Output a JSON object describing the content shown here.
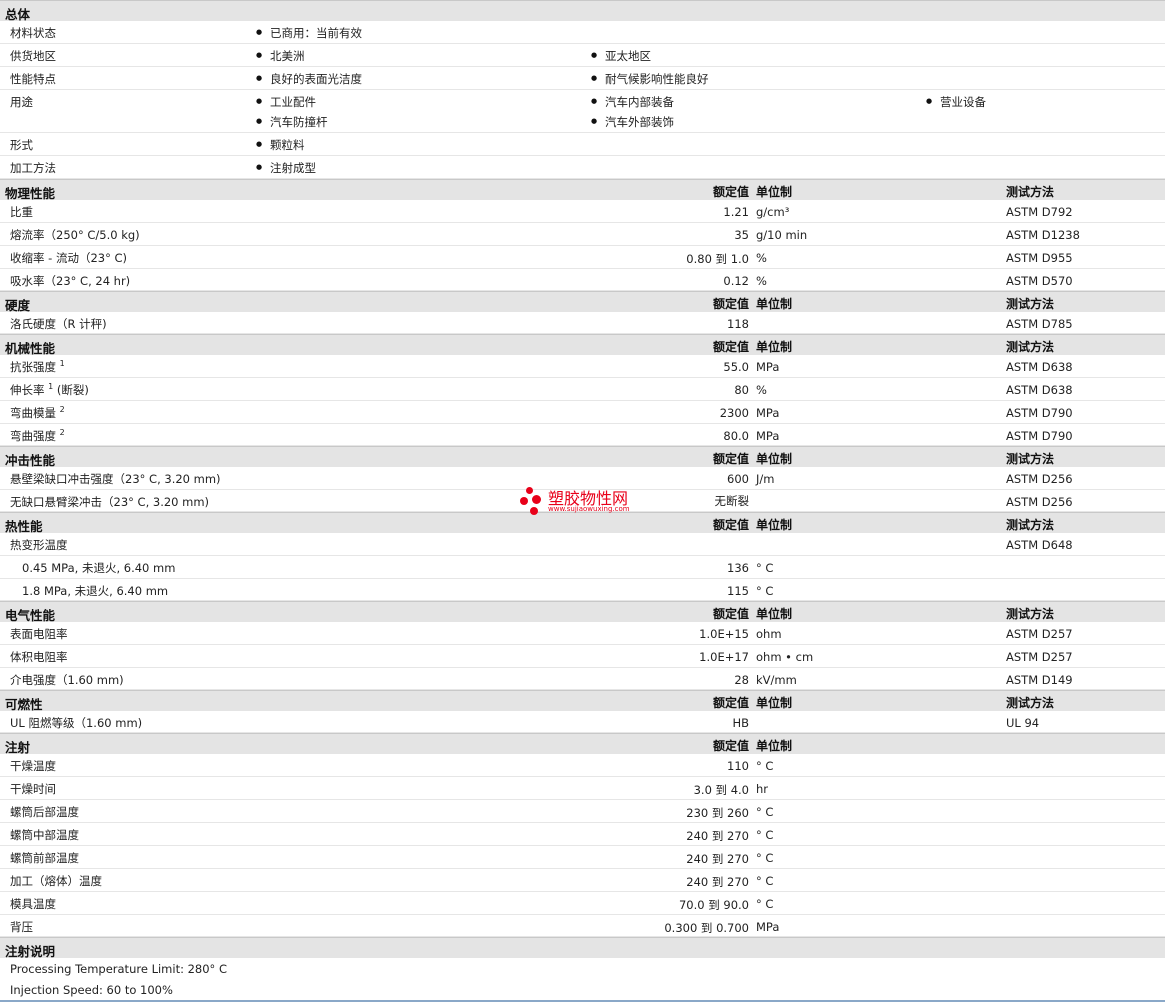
{
  "general": {
    "title": "总体",
    "rows": [
      {
        "label": "材料状态",
        "items": [
          "已商用：当前有效"
        ]
      },
      {
        "label": "供货地区",
        "items": [
          "北美洲",
          "亚太地区"
        ]
      },
      {
        "label": "性能特点",
        "items": [
          "良好的表面光洁度",
          "耐气候影响性能良好"
        ]
      },
      {
        "label": "用途",
        "items": [
          "工业配件",
          "汽车内部装备",
          "营业设备",
          "汽车防撞杆",
          "汽车外部装饰"
        ]
      },
      {
        "label": "形式",
        "items": [
          "颗粒料"
        ]
      },
      {
        "label": "加工方法",
        "items": [
          "注射成型"
        ]
      }
    ]
  },
  "headers": {
    "value": "额定值",
    "unit": "单位制",
    "method": "测试方法"
  },
  "sections": [
    {
      "title": "物理性能",
      "rows": [
        {
          "label": "比重",
          "value": "1.21",
          "unit": "g/cm³",
          "method": "ASTM D792"
        },
        {
          "label": "熔流率（250° C/5.0 kg)",
          "value": "35",
          "unit": "g/10 min",
          "method": "ASTM D1238"
        },
        {
          "label": "收缩率 - 流动（23° C)",
          "value": "0.80 到  1.0",
          "unit": "%",
          "method": "ASTM D955"
        },
        {
          "label": "吸水率（23° C, 24 hr)",
          "value": "0.12",
          "unit": "%",
          "method": "ASTM D570"
        }
      ]
    },
    {
      "title": "硬度",
      "rows": [
        {
          "label": "洛氏硬度（R 计秤)",
          "value": "118",
          "unit": "",
          "method": "ASTM D785"
        }
      ]
    },
    {
      "title": "机械性能",
      "rows": [
        {
          "label": "抗张强度",
          "sup": "1",
          "label2": "",
          "value": "55.0",
          "unit": "MPa",
          "method": "ASTM D638"
        },
        {
          "label": "伸长率",
          "sup": "1",
          "label2": " (断裂)",
          "value": "80",
          "unit": "%",
          "method": "ASTM D638"
        },
        {
          "label": "弯曲模量",
          "sup": "2",
          "label2": "",
          "value": "2300",
          "unit": "MPa",
          "method": "ASTM D790"
        },
        {
          "label": "弯曲强度",
          "sup": "2",
          "label2": "",
          "value": "80.0",
          "unit": "MPa",
          "method": "ASTM D790"
        }
      ]
    },
    {
      "title": "冲击性能",
      "rows": [
        {
          "label": "悬壁梁缺口冲击强度（23° C, 3.20 mm)",
          "value": "600",
          "unit": "J/m",
          "method": "ASTM D256"
        },
        {
          "label": "无缺口悬臂梁冲击（23° C, 3.20 mm)",
          "value": "无断裂",
          "unit": "",
          "method": "ASTM D256"
        }
      ]
    },
    {
      "title": "热性能",
      "rows": [
        {
          "label": "热变形温度",
          "value": "",
          "unit": "",
          "method": "ASTM D648"
        },
        {
          "label": "0.45 MPa, 未退火, 6.40 mm",
          "sub": true,
          "value": "136",
          "unit": "° C",
          "method": ""
        },
        {
          "label": "1.8 MPa, 未退火, 6.40 mm",
          "sub": true,
          "value": "115",
          "unit": "° C",
          "method": ""
        }
      ]
    },
    {
      "title": "电气性能",
      "rows": [
        {
          "label": "表面电阻率",
          "value": "1.0E+15",
          "unit": "ohm",
          "method": "ASTM D257"
        },
        {
          "label": "体积电阻率",
          "value": "1.0E+17",
          "unit": "ohm • cm",
          "method": "ASTM D257"
        },
        {
          "label": "介电强度（1.60 mm)",
          "value": "28",
          "unit": "kV/mm",
          "method": "ASTM D149"
        }
      ]
    },
    {
      "title": "可燃性",
      "rows": [
        {
          "label": "UL 阻燃等级（1.60 mm)",
          "value": "HB",
          "unit": "",
          "method": "UL 94"
        }
      ]
    },
    {
      "title": "注射",
      "nomethod": true,
      "rows": [
        {
          "label": "干燥温度",
          "value": "110",
          "unit": "° C",
          "method": ""
        },
        {
          "label": "干燥时间",
          "value": "3.0 到  4.0",
          "unit": "hr",
          "method": ""
        },
        {
          "label": "螺筒后部温度",
          "value": "230 到  260",
          "unit": "° C",
          "method": ""
        },
        {
          "label": "螺筒中部温度",
          "value": "240 到  270",
          "unit": "° C",
          "method": ""
        },
        {
          "label": "螺筒前部温度",
          "value": "240 到  270",
          "unit": "° C",
          "method": ""
        },
        {
          "label": "加工（熔体）温度",
          "value": "240 到  270",
          "unit": "° C",
          "method": ""
        },
        {
          "label": "模具温度",
          "value": "70.0 到  90.0",
          "unit": "° C",
          "method": ""
        },
        {
          "label": "背压",
          "value": "0.300 到  0.700",
          "unit": "MPa",
          "method": ""
        }
      ]
    }
  ],
  "notes": {
    "title": "注射说明",
    "lines": [
      "Processing Temperature Limit: 280° C",
      "Injection Speed: 60 to 100%"
    ]
  },
  "watermark": {
    "name": "塑胶物性网",
    "url": "www.sujiaowuxing.com",
    "color": "#e8001a"
  }
}
